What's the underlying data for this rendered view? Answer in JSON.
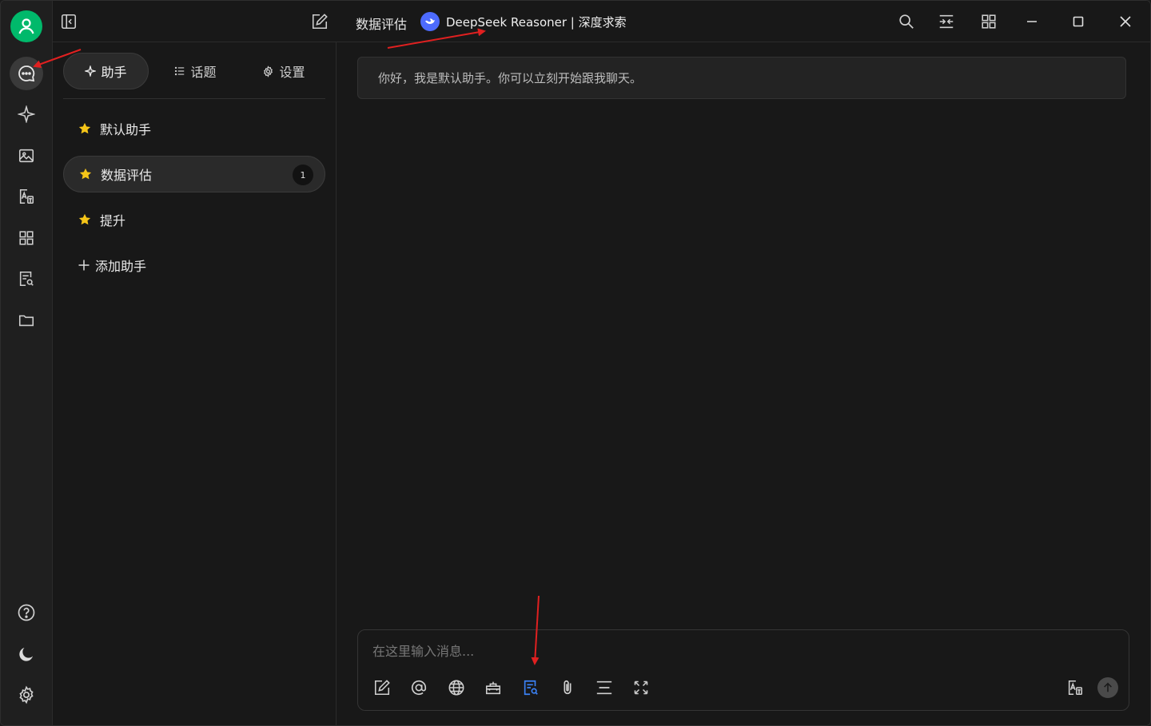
{
  "topbar": {
    "chat_title": "数据评估",
    "model_name": "DeepSeek Reasoner | 深度求索"
  },
  "panel": {
    "tabs": [
      {
        "label": "助手",
        "icon": "sparkle-icon",
        "active": true
      },
      {
        "label": "话题",
        "icon": "list-icon",
        "active": false
      },
      {
        "label": "设置",
        "icon": "gear-icon",
        "active": false
      }
    ],
    "assistants": [
      {
        "label": "默认助手",
        "icon": "star-icon",
        "active": false
      },
      {
        "label": "数据评估",
        "icon": "star-icon",
        "active": true,
        "badge": "1"
      },
      {
        "label": "提升",
        "icon": "star-icon",
        "active": false
      }
    ],
    "add_label": "添加助手"
  },
  "chat": {
    "greeting": "你好，我是默认助手。你可以立刻开始跟我聊天。",
    "input_placeholder": "在这里输入消息..."
  },
  "colors": {
    "accent_green": "#00b96b",
    "star": "#f5c518",
    "model_blue": "#4d6bfe",
    "tool_active": "#3b82f6",
    "annotation": "#e02020"
  }
}
